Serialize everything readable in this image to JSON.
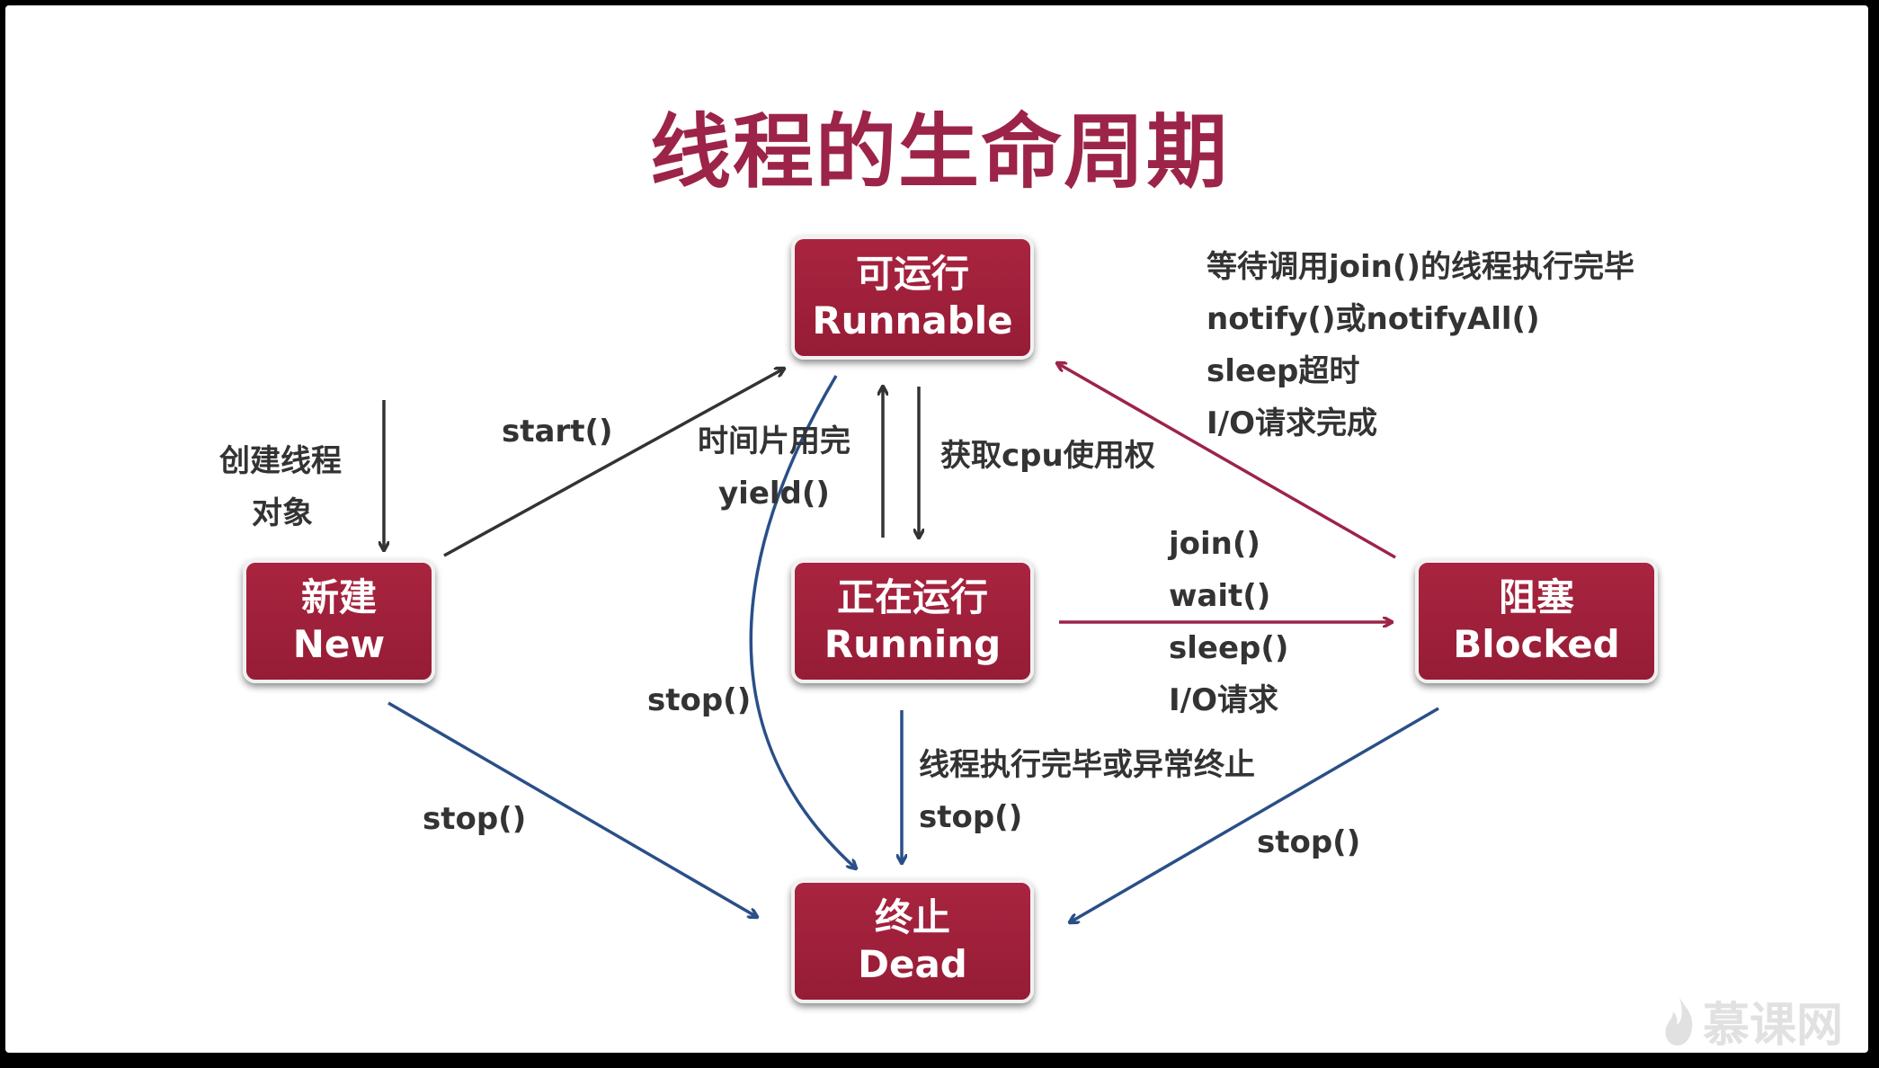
{
  "diagram": {
    "title": "线程的生命周期",
    "states": {
      "runnable": {
        "zh": "可运行",
        "en": "Runnable"
      },
      "new": {
        "zh": "新建",
        "en": "New"
      },
      "running": {
        "zh": "正在运行",
        "en": "Running"
      },
      "blocked": {
        "zh": "阻塞",
        "en": "Blocked"
      },
      "dead": {
        "zh": "终止",
        "en": "Dead"
      }
    },
    "labels": {
      "create_line1": "创建线程",
      "create_line2": "对象",
      "start": "start()",
      "timeslice_line1": "时间片用完",
      "timeslice_line2": "yield()",
      "get_cpu": "获取cpu使用权",
      "unblock": [
        "等待调用join()的线程执行完毕",
        "notify()或notifyAll()",
        "sleep超时",
        "I/O请求完成"
      ],
      "block": [
        "join()",
        "wait()",
        "sleep()",
        "I/O请求"
      ],
      "stop_runnable": "stop()",
      "stop_new": "stop()",
      "running_end_line1": "线程执行完毕或异常终止",
      "running_end_line2": "stop()",
      "stop_blocked": "stop()"
    },
    "colors": {
      "title": "#9c2448",
      "box": "#a21f3c",
      "arrow_dark": "#333333",
      "arrow_red": "#9c2448",
      "arrow_blue": "#2a4f88"
    },
    "logo": {
      "text": "慕课网",
      "icon": "flame-icon"
    }
  }
}
